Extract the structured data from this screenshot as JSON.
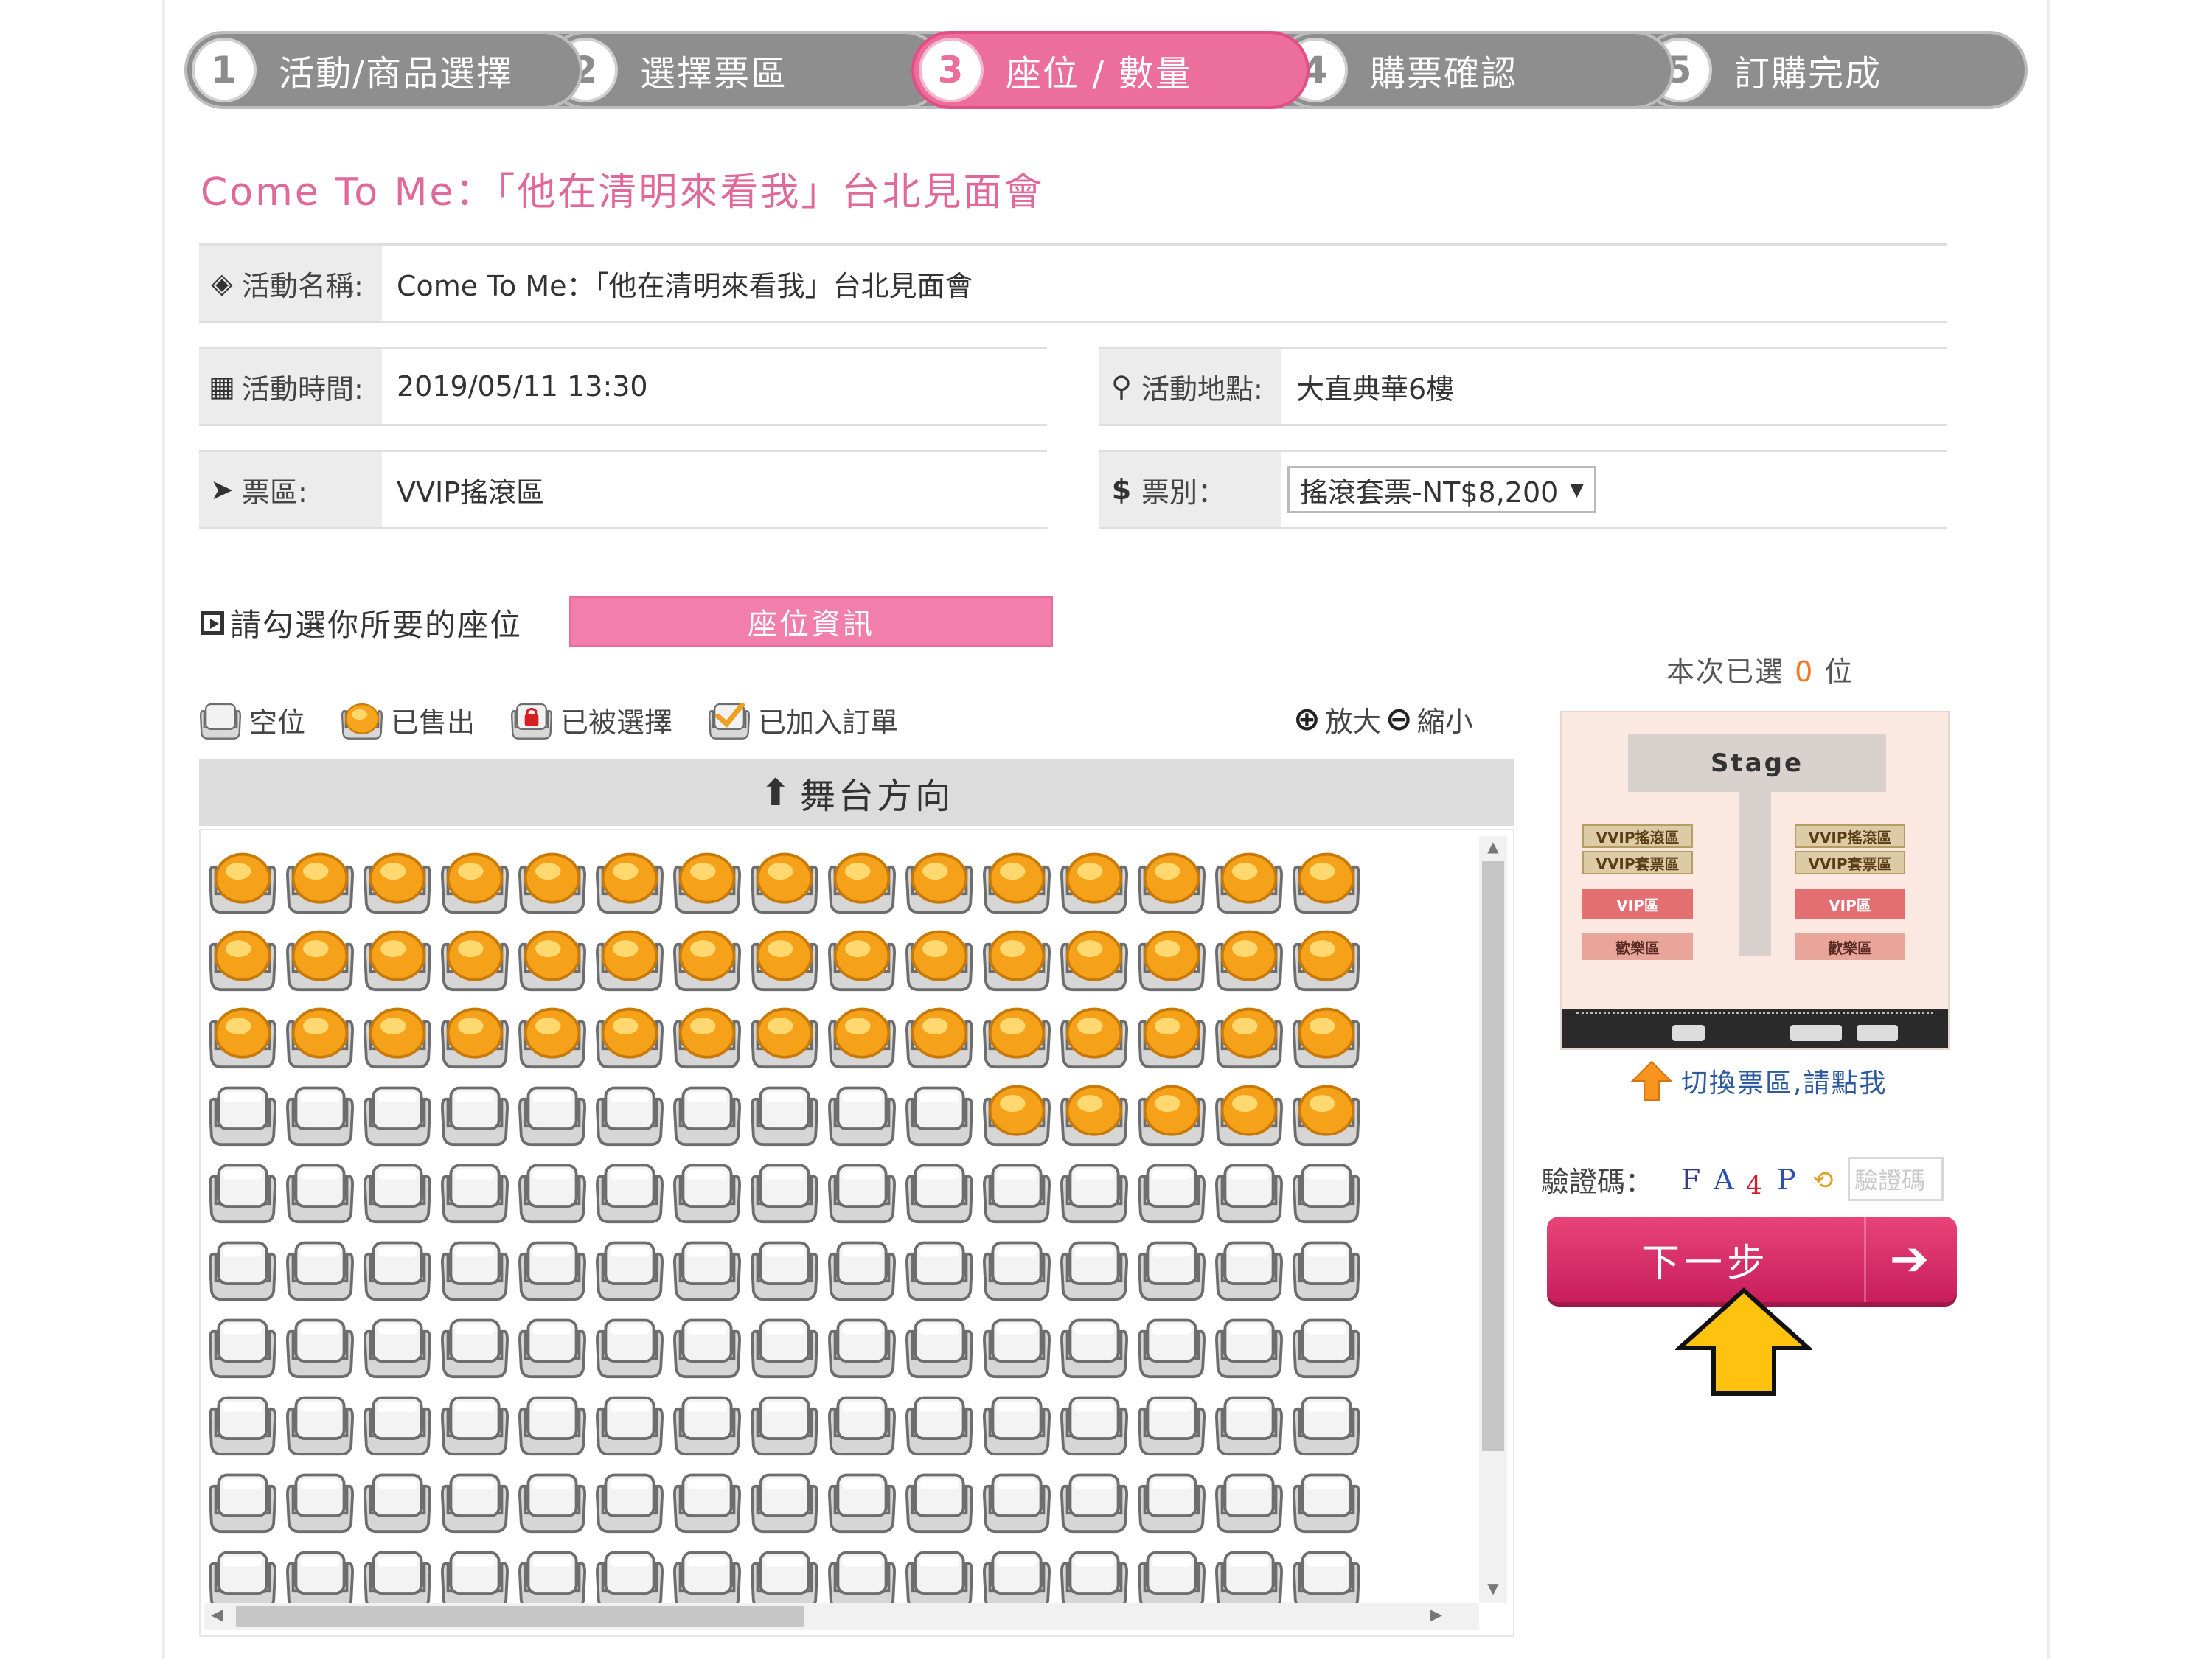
{
  "steps": [
    {
      "num": "1",
      "label": "活動/商品選擇"
    },
    {
      "num": "2",
      "label": "選擇票區"
    },
    {
      "num": "3",
      "label": "座位 / 數量"
    },
    {
      "num": "4",
      "label": "購票確認"
    },
    {
      "num": "5",
      "label": "訂購完成"
    }
  ],
  "active_step": 3,
  "event": {
    "title": "Come To Me：「他在清明來看我」台北見面會",
    "name_label": "活動名稱:",
    "name_value": "Come To Me：「他在清明來看我」台北見面會",
    "time_label": "活動時間:",
    "time_value": "2019/05/11 13:30",
    "place_label": "活動地點:",
    "place_value": "大直典華6樓",
    "zone_label": "票區:",
    "zone_value": "VVIP搖滾區",
    "ticket_label": "票別：",
    "ticket_value": "搖滾套票-NT$8,200"
  },
  "seat_section": {
    "prompt": "請勾選你所要的座位",
    "info_button": "座位資訊",
    "legend": {
      "empty": "空位",
      "sold": "已售出",
      "taken": "已被選擇",
      "added": "已加入訂單"
    },
    "zoom_in": "放大",
    "zoom_out": "縮小",
    "stage_direction": "舞台方向",
    "rows": [
      "SSSSSSSSSSSSSSS",
      "SSSSSSSSSSSSSSS",
      "SSSSSSSSSSSSSSS",
      "EEEEEEEEEESSSSS",
      "EEEEEEEEEEEEEEE",
      "EEEEEEEEEEEEEEE",
      "EEEEEEEEEEEEEEE",
      "EEEEEEEEEEEEEEE",
      "EEEEEEEEEEEEEEE",
      "EEEEEEEEEEEEEEE"
    ]
  },
  "selection": {
    "prefix": "本次已選",
    "count": "0",
    "suffix": "位"
  },
  "venue_map": {
    "stage": "Stage",
    "vvip_rock": "VVIP搖滾區",
    "vvip_set": "VVIP套票區",
    "vip": "VIP區",
    "fun": "歡樂區"
  },
  "switch_zone": "切換票區,請點我",
  "captcha": {
    "label": "驗證碼：",
    "chars": [
      "F",
      "A",
      "4",
      "P"
    ],
    "placeholder": "驗證碼"
  },
  "next_button": "下一步",
  "colors": {
    "accent_pink": "#ec6f9b",
    "button_pink": "#d62a66",
    "step_gray": "#8e8e8e",
    "sold_orange": "#f5a623",
    "highlight_arrow": "#ffc20e"
  }
}
